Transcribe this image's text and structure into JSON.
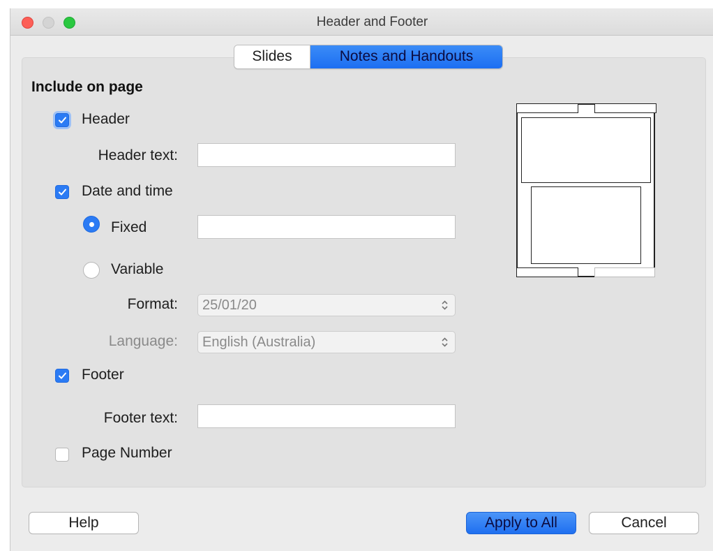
{
  "window": {
    "title": "Header and Footer"
  },
  "tabs": [
    {
      "label": "Slides",
      "selected": false
    },
    {
      "label": "Notes and Handouts",
      "selected": true
    }
  ],
  "section_title": "Include on page",
  "header": {
    "label": "Header",
    "checked": true,
    "text_label": "Header text:",
    "text_value": ""
  },
  "date_time": {
    "label": "Date and time",
    "checked": true,
    "fixed_label": "Fixed",
    "fixed_selected": true,
    "fixed_value": "",
    "variable_label": "Variable",
    "variable_selected": false,
    "format_label": "Format:",
    "format_value": "25/01/20",
    "language_label": "Language:",
    "language_value": "English (Australia)"
  },
  "footer": {
    "label": "Footer",
    "checked": true,
    "text_label": "Footer text:",
    "text_value": ""
  },
  "page_number": {
    "label": "Page Number",
    "checked": false
  },
  "buttons": {
    "help": "Help",
    "apply_all": "Apply to All",
    "cancel": "Cancel"
  },
  "colors": {
    "accent": "#2b7bf4",
    "close": "#fc5f57",
    "zoom": "#2ac840"
  }
}
